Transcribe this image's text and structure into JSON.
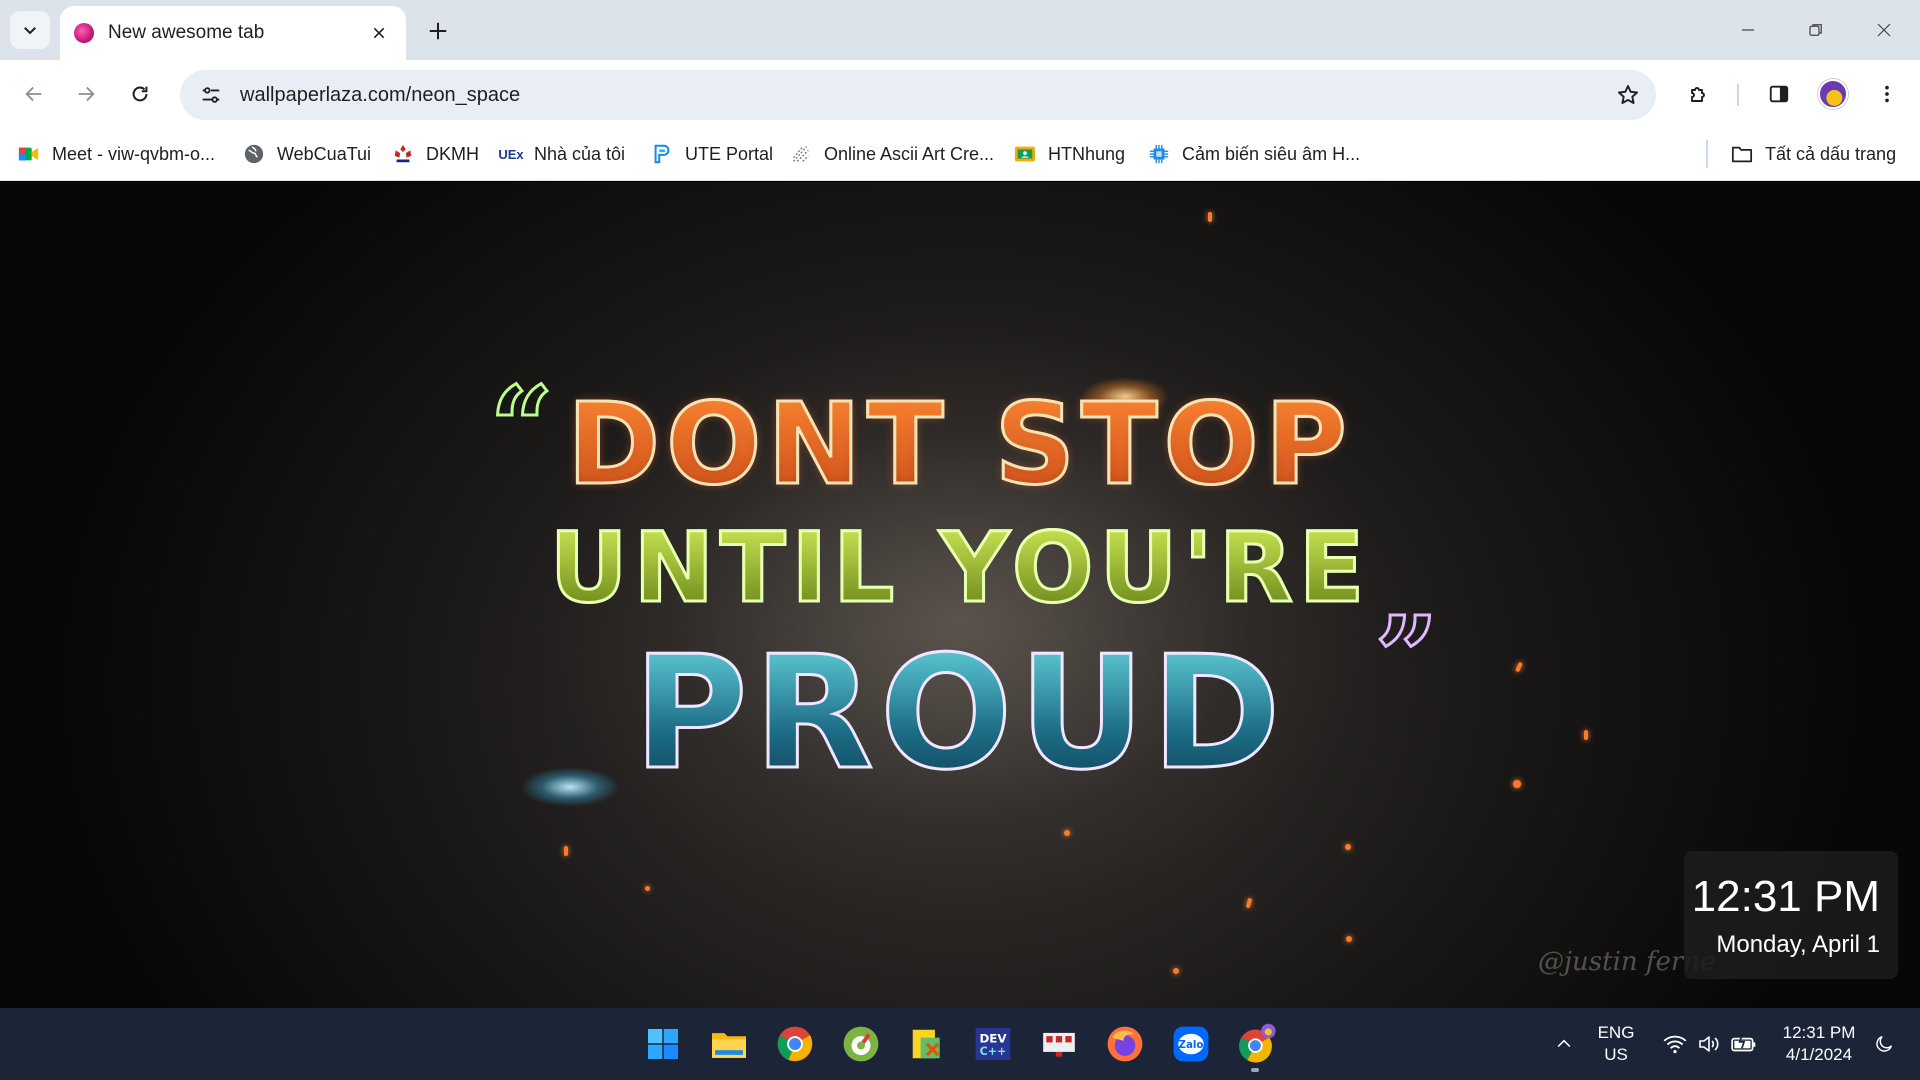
{
  "browser": {
    "tab": {
      "title": "New awesome tab",
      "favicon": "neon-ball-favicon"
    },
    "address_bar": {
      "url": "wallpaperlaza.com/neon_space"
    },
    "bookmarks": [
      {
        "label": "Meet - viw-qvbm-o...",
        "icon": "google-meet-icon"
      },
      {
        "label": "WebCuaTui",
        "icon": "globe-icon"
      },
      {
        "label": "DKMH",
        "icon": "hcmute-logo-icon"
      },
      {
        "label": "Nhà của tôi",
        "icon": "utex-icon"
      },
      {
        "label": "UTE Portal",
        "icon": "ute-portal-icon"
      },
      {
        "label": "Online Ascii Art Cre...",
        "icon": "ascii-art-icon"
      },
      {
        "label": "HTNhung",
        "icon": "classroom-icon"
      },
      {
        "label": "Cảm biến siêu âm H...",
        "icon": "chip-icon"
      }
    ],
    "all_bookmarks": "Tất cả dấu trang"
  },
  "wallpaper": {
    "quote_lines": [
      "DONT STOP",
      "UNTIL YOU'RE",
      "PROUD"
    ],
    "quote_open": "“",
    "quote_close": "”",
    "watermark": "@justin ferne"
  },
  "clock_popup": {
    "time": "12:31 PM",
    "date": "Monday, April 1"
  },
  "taskbar": {
    "apps": [
      "windows-start-icon",
      "file-explorer-icon",
      "chrome-icon",
      "coc-coc-icon",
      "tools-app-icon",
      "dev-cpp-icon",
      "network-app-icon",
      "firefox-icon",
      "zalo-icon",
      "chrome-profile-icon"
    ],
    "language": {
      "line1": "ENG",
      "line2": "US"
    },
    "time": "12:31 PM",
    "date": "4/1/2024"
  },
  "colors": {
    "tabstrip": "#dde3ea",
    "taskbar": "#1c2538",
    "omnibox": "#e9eef6"
  }
}
